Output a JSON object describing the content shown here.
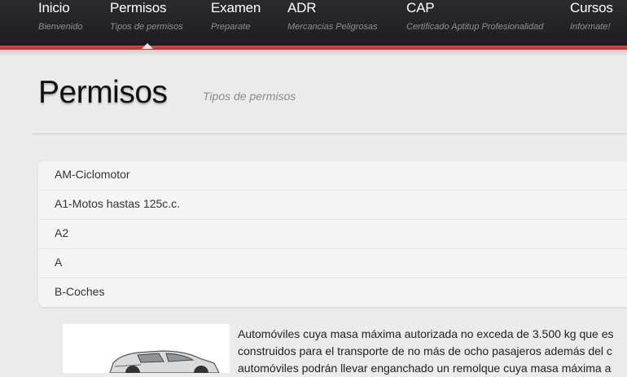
{
  "nav": [
    {
      "label": "Inicio",
      "sub": "Bienvenido"
    },
    {
      "label": "Permisos",
      "sub": "Tipos de permisos"
    },
    {
      "label": "Examen",
      "sub": "Preparate"
    },
    {
      "label": "ADR",
      "sub": "Mercancias Peligrosas"
    },
    {
      "label": "CAP",
      "sub": "Certificado Aptitup Profesionalidad"
    },
    {
      "label": "Cursos",
      "sub": "Informate!"
    }
  ],
  "colors": {
    "nav_bg": "#1f2023",
    "accent": "#d33538",
    "page_bg": "#ebebeb"
  },
  "header": {
    "title": "Permisos",
    "subtitle": "Tipos de permisos"
  },
  "permits": [
    "AM-Ciclomotor",
    "A1-Motos hastas 125c.c.",
    "A2",
    "A",
    "B-Coches"
  ],
  "content": {
    "lines": [
      "Automóviles cuya masa máxima autorizada no exceda de 3.500 kg que es",
      "construidos para el transporte de no más de ocho pasajeros además del c",
      "automóviles podrán llevar enganchado un remolque cuya masa máxima a"
    ]
  }
}
